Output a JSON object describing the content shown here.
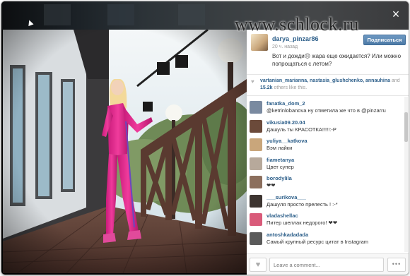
{
  "watermark": "www.schlock.ru",
  "close_glyph": "×",
  "post": {
    "username": "darya_pinzar86",
    "time_ago": "20 ч. назад",
    "caption": "Вот и дожди☹ жара еще ожидается? Или можно попрощаться с летом?",
    "follow_label": "Подписаться"
  },
  "likes": {
    "names": "vartanian_marianna, nastasia_glushchenko, annauhina",
    "and_text": "and",
    "count": "15.2k",
    "others_text": "others like this."
  },
  "comments": [
    {
      "user": "fanatka_dom_2",
      "text": "@ketrinlobanova ну отметила же что в @pinzarru",
      "avatar_color": "#7a8aa0"
    },
    {
      "user": "vikusia09.20.04",
      "text": "Дашуль ты КРАСОТКА!!!!!:-P",
      "avatar_color": "#6b4a3a"
    },
    {
      "user": "yuliya__katkova",
      "text": "Вэм лайки",
      "avatar_color": "#c9a67b"
    },
    {
      "user": "fiametanya",
      "text": "Цвет супер",
      "avatar_color": "#b7a99b"
    },
    {
      "user": "borodylila",
      "text": "❤❤",
      "avatar_color": "#8c6f5d"
    },
    {
      "user": "___surikova___",
      "text": "Дашуля просто прелесть ! :-*",
      "avatar_color": "#3d3531"
    },
    {
      "user": "vladashellac",
      "text": "Питер шеллак недорого! ❤❤",
      "avatar_color": "#d95b7a"
    },
    {
      "user": "antoshkadadada",
      "text": "Самый крупный ресурс цитат в Instagram",
      "avatar_color": "#5a5a5a"
    }
  ],
  "composer": {
    "placeholder": "Leave a comment...",
    "like_icon_glyph": "♥",
    "more_glyph": "•••"
  },
  "colors": {
    "link": "#2d5f8a",
    "follow_button": "#5584b1",
    "outfit_pink": "#e22d8e"
  }
}
